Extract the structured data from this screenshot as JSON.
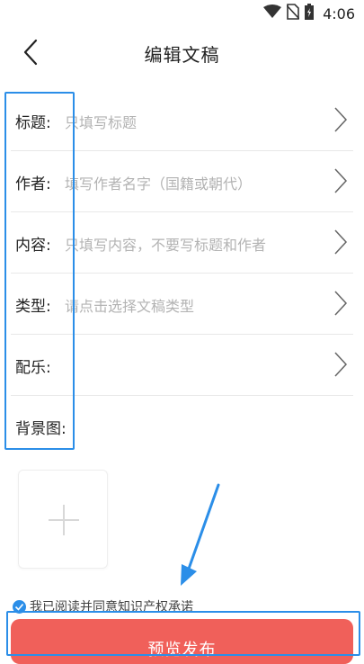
{
  "status_bar": {
    "time": "4:06"
  },
  "header": {
    "title": "编辑文稿"
  },
  "form": {
    "rows": [
      {
        "label": "标题:",
        "placeholder": "只填写标题",
        "has_arrow": true
      },
      {
        "label": "作者:",
        "placeholder": "填写作者名字（国籍或朝代）",
        "has_arrow": true
      },
      {
        "label": "内容:",
        "placeholder": "只填写内容，不要写标题和作者",
        "has_arrow": true
      },
      {
        "label": "类型:",
        "placeholder": "请点击选择文稿类型",
        "has_arrow": true
      },
      {
        "label": "配乐:",
        "placeholder": "",
        "has_arrow": true
      },
      {
        "label": "背景图:",
        "placeholder": "",
        "has_arrow": false
      }
    ]
  },
  "agreement": {
    "text": "我已阅读并同意知识产权承诺",
    "checked": true
  },
  "publish_button": {
    "label": "预览发布"
  },
  "colors": {
    "accent_blue": "#2b8ee8",
    "button_red": "#f0605a",
    "placeholder_gray": "#b3b3b3"
  },
  "icons": [
    "wifi-icon",
    "no-sim-icon",
    "battery-icon",
    "back-arrow-icon",
    "chevron-right-icon",
    "plus-icon",
    "checkbox-checked-icon"
  ]
}
